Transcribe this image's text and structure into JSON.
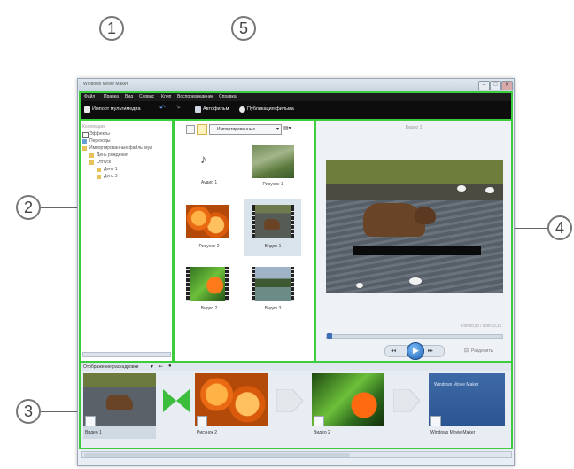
{
  "callouts": [
    "1",
    "5",
    "2",
    "4",
    "3"
  ],
  "window": {
    "title": "Windows Movie Maker",
    "controls": [
      "–",
      "□",
      "✕"
    ]
  },
  "menu": [
    "Файл",
    "Правка",
    "Вид",
    "Сервис",
    "Клип",
    "Воспроизведение",
    "Справка"
  ],
  "toolbar": {
    "import": "Импорт мультимедиа",
    "autofilm": "Автофильм",
    "publish": "Публикация фильма"
  },
  "tree": {
    "header": "Коллекции",
    "items": [
      "Эффекты",
      "Переходы",
      "Импортированные файлы мул",
      "День рождения",
      "Отпуск",
      "День 1",
      "День 2"
    ]
  },
  "contents": {
    "view_dropdown": "Импортированные",
    "items": [
      {
        "label": "Аудио 1",
        "kind": "audio"
      },
      {
        "label": "Рисунок 1",
        "kind": "photo"
      },
      {
        "label": "Рисунок 2",
        "kind": "flowers"
      },
      {
        "label": "Видео 1",
        "kind": "bear-video"
      },
      {
        "label": "Видео 2",
        "kind": "leaf-video"
      },
      {
        "label": "Видео 3",
        "kind": "landscape-video"
      }
    ]
  },
  "preview": {
    "title": "Видео 1",
    "time": "0:00:00,00 / 0:00:12,12",
    "split_label": "Разделить"
  },
  "storyboard": {
    "header": "Отображение раскадровки",
    "items": [
      {
        "label": "Видео 1"
      },
      {
        "label": "Рисунок 2"
      },
      {
        "label": "Видео 2"
      },
      {
        "label": "Windows Movie Maker"
      }
    ],
    "title_card": "Windows Movie Maker"
  },
  "colors": {
    "highlight": "#3dcc3d",
    "toolbar": "#0d0d0d"
  }
}
